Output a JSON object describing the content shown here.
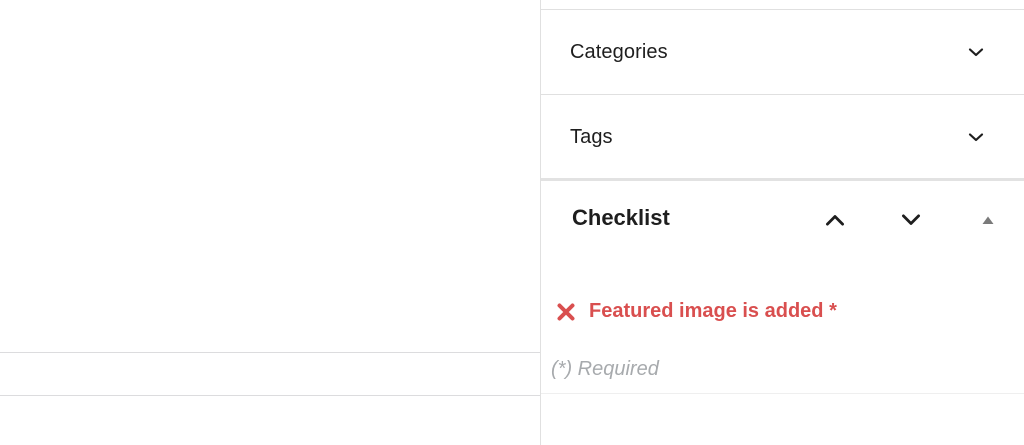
{
  "sidebar": {
    "panels": [
      {
        "label": "Categories",
        "expanded": false
      },
      {
        "label": "Tags",
        "expanded": false
      }
    ],
    "checklist": {
      "title": "Checklist",
      "move_up_icon": "chevron-up-icon",
      "move_down_icon": "chevron-down-icon",
      "collapse_icon": "triangle-up-icon",
      "items": [
        {
          "label": "Featured image is added *",
          "status": "failed",
          "icon": "x-icon",
          "color": "#d94f4f"
        }
      ],
      "required_note": "(*) Required"
    }
  },
  "colors": {
    "error": "#d94f4f",
    "muted_text": "#a7aaad",
    "border": "#e0e0e0",
    "text": "#1e1e1e"
  }
}
